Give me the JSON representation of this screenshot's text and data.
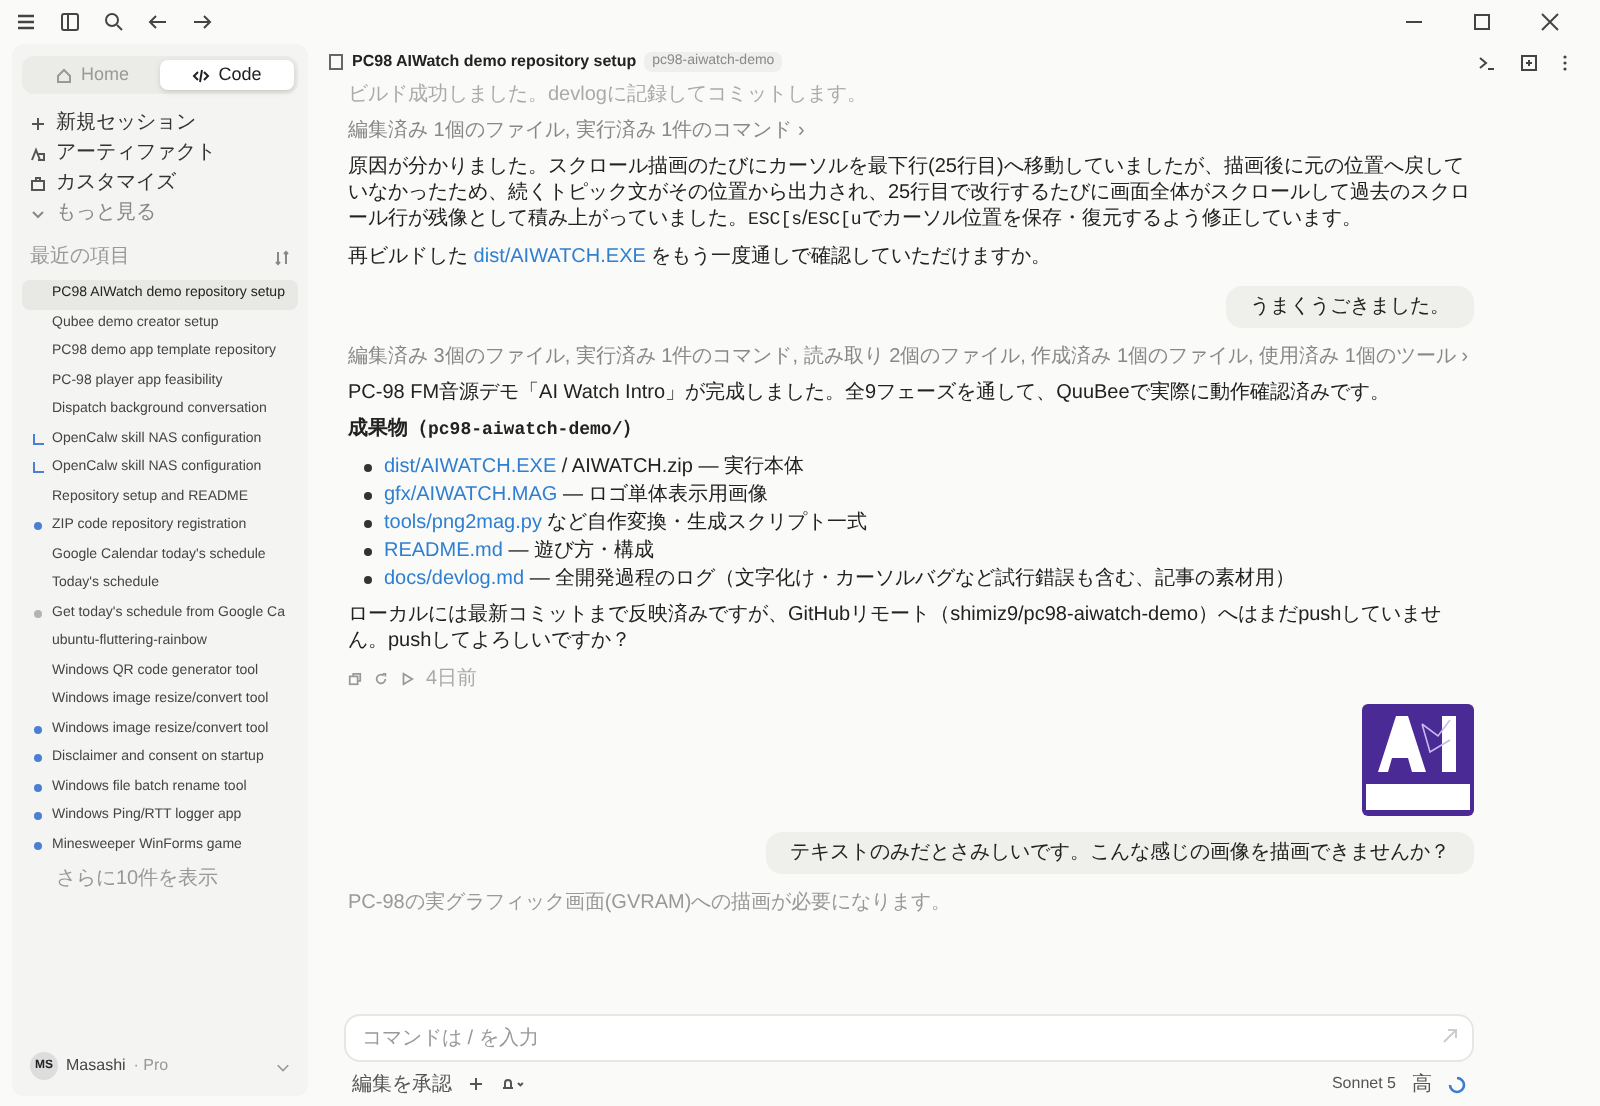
{
  "tabs": [
    {
      "label": "Home",
      "selected": false
    },
    {
      "label": "Code",
      "selected": true
    }
  ],
  "nav": [
    "新規セッション",
    "アーティファクト",
    "カスタマイズ",
    "もっと見る"
  ],
  "recents": {
    "title": "最近の項目",
    "items": [
      {
        "label": "PC98 AIWatch demo repository setup",
        "kind": "plain",
        "selected": true
      },
      {
        "label": "Qubee demo creator setup",
        "kind": "plain",
        "selected": false
      },
      {
        "label": "PC98 demo app template repository",
        "kind": "plain",
        "selected": false
      },
      {
        "label": "PC-98 player app feasibility",
        "kind": "plain",
        "selected": false
      },
      {
        "label": "Dispatch background conversation",
        "kind": "plain",
        "selected": false
      },
      {
        "label": "OpenCalw skill NAS configuration",
        "kind": "branch",
        "selected": false
      },
      {
        "label": "OpenCalw skill NAS configuration",
        "kind": "branch",
        "selected": false
      },
      {
        "label": "Repository setup and README",
        "kind": "plain",
        "selected": false
      },
      {
        "label": "ZIP code repository registration",
        "kind": "dot",
        "color": "#4a7fd4",
        "selected": false
      },
      {
        "label": "Google Calendar today's schedule",
        "kind": "plain",
        "selected": false
      },
      {
        "label": "Today's schedule",
        "kind": "plain",
        "selected": false
      },
      {
        "label": "Get today's schedule from Google Ca",
        "kind": "dot",
        "color": "#b4b4b4",
        "selected": false
      },
      {
        "label": "ubuntu-fluttering-rainbow",
        "kind": "plain",
        "selected": false
      },
      {
        "label": "Windows QR code generator tool",
        "kind": "plain",
        "selected": false
      },
      {
        "label": "Windows image resize/convert tool",
        "kind": "plain",
        "selected": false
      },
      {
        "label": "Windows image resize/convert tool",
        "kind": "dot",
        "color": "#4a7fd4",
        "selected": false
      },
      {
        "label": "Disclaimer and consent on startup",
        "kind": "dot",
        "color": "#4a7fd4",
        "selected": false
      },
      {
        "label": "Windows file batch rename tool",
        "kind": "dot",
        "color": "#4a7fd4",
        "selected": false
      },
      {
        "label": "Windows Ping/RTT logger app",
        "kind": "dot",
        "color": "#4a7fd4",
        "selected": false
      },
      {
        "label": "Minesweeper WinForms game",
        "kind": "dot",
        "color": "#4a7fd4",
        "selected": false
      }
    ],
    "more": "さらに10件を表示"
  },
  "user": {
    "initials": "MS",
    "name": "Masashi",
    "plan": "· Pro"
  },
  "header": {
    "title": "PC98 AIWatch demo repository setup",
    "tag": "pc98-aiwatch-demo"
  },
  "messages": [
    {
      "kind": "status",
      "text": "ビルド成功しました。devlogに記録してコミットします。"
    },
    {
      "kind": "tools",
      "text": "編集済み 1個のファイル, 実行済み 1件のコマンド ›"
    },
    {
      "kind": "text",
      "parts": [
        {
          "kind": "plain",
          "text": "原因が分かりました。スクロール描画のたびにカーソルを最下行(25行目)へ移動していましたが、描画後に元の位置へ戻していなかったため、続くトピック文がその位置から出力され、25行目で改行するたびに画面全体がスクロールして過去のスクロール行が残像として積み上がっていました。"
        },
        {
          "kind": "code",
          "text": "ESC[s"
        },
        {
          "kind": "plain",
          "text": "/"
        },
        {
          "kind": "code",
          "text": "ESC[u"
        },
        {
          "kind": "plain",
          "text": "でカーソル位置を保存・復元するよう修正しています。"
        }
      ]
    },
    {
      "kind": "text",
      "parts": [
        {
          "kind": "plain",
          "text": "再ビルドした "
        },
        {
          "kind": "link",
          "text": "dist/AIWATCH.EXE"
        },
        {
          "kind": "plain",
          "text": " をもう一度通しで確認していただけますか。"
        }
      ]
    },
    {
      "kind": "user",
      "text": "うまくうごきました。"
    },
    {
      "kind": "tools",
      "text": "編集済み 3個のファイル, 実行済み 1件のコマンド, 読み取り 2個のファイル, 作成済み 1個のファイル, 使用済み 1個のツール ›"
    },
    {
      "kind": "text",
      "parts": [
        {
          "kind": "plain",
          "text": "PC-98 FM音源デモ「AI Watch Intro」が完成しました。全9フェーズを通して、QuuBeeで実際に動作確認済みです。"
        }
      ]
    },
    {
      "kind": "heading",
      "parts": [
        {
          "kind": "plain",
          "text": "成果物（"
        },
        {
          "kind": "code",
          "text": "pc98-aiwatch-demo/"
        },
        {
          "kind": "plain",
          "text": "）"
        }
      ]
    },
    {
      "kind": "bullets",
      "items": [
        [
          {
            "kind": "link",
            "text": "dist/AIWATCH.EXE"
          },
          {
            "kind": "plain",
            "text": " / AIWATCH.zip — 実行本体"
          }
        ],
        [
          {
            "kind": "link",
            "text": "gfx/AIWATCH.MAG"
          },
          {
            "kind": "plain",
            "text": " — ロゴ単体表示用画像"
          }
        ],
        [
          {
            "kind": "link",
            "text": "tools/png2mag.py"
          },
          {
            "kind": "plain",
            "text": " など自作変換・生成スクリプト一式"
          }
        ],
        [
          {
            "kind": "link",
            "text": "README.md"
          },
          {
            "kind": "plain",
            "text": " — 遊び方・構成"
          }
        ],
        [
          {
            "kind": "link",
            "text": "docs/devlog.md"
          },
          {
            "kind": "plain",
            "text": " — 全開発過程のログ（文字化け・カーソルバグなど試行錯誤も含む、記事の素材用）"
          }
        ]
      ]
    },
    {
      "kind": "text",
      "parts": [
        {
          "kind": "plain",
          "text": "ローカルには最新コミットまで反映済みですが、GitHubリモート（shimiz9/pc98-aiwatch-demo）へはまだpushしていません。pushしてよろしいですか？"
        }
      ]
    },
    {
      "kind": "actions",
      "text": "4日前"
    },
    {
      "kind": "image"
    },
    {
      "kind": "user",
      "text": "テキストのみだとさみしいです。こんな感じの画像を描画できませんか？"
    },
    {
      "kind": "fade",
      "text": "PC-98の実グラフィック画面(GVRAM)への描画が必要になります。"
    }
  ],
  "composer": {
    "placeholder": "コマンドは / を入力",
    "accept": "編集を承認",
    "model": "Sonnet 5",
    "effort": "高"
  }
}
